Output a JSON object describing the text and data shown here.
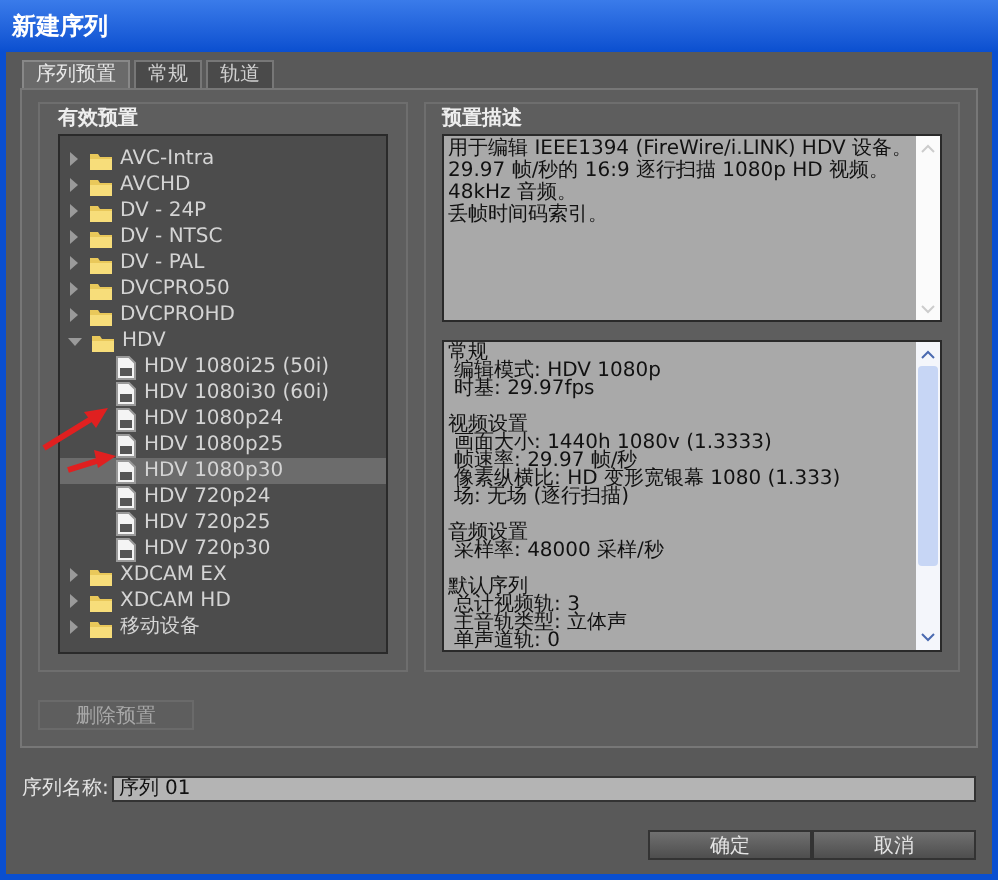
{
  "window": {
    "title": "新建序列"
  },
  "tabs": [
    {
      "label": "序列预置",
      "selected": true
    },
    {
      "label": "常规",
      "selected": false
    },
    {
      "label": "轨道",
      "selected": false
    }
  ],
  "presets": {
    "heading": "有效预置",
    "items": [
      {
        "label": "AVC-Intra",
        "kind": "folder",
        "expanded": false,
        "selected": false
      },
      {
        "label": "AVCHD",
        "kind": "folder",
        "expanded": false,
        "selected": false
      },
      {
        "label": "DV - 24P",
        "kind": "folder",
        "expanded": false,
        "selected": false
      },
      {
        "label": "DV - NTSC",
        "kind": "folder",
        "expanded": false,
        "selected": false
      },
      {
        "label": "DV - PAL",
        "kind": "folder",
        "expanded": false,
        "selected": false
      },
      {
        "label": "DVCPRO50",
        "kind": "folder",
        "expanded": false,
        "selected": false
      },
      {
        "label": "DVCPROHD",
        "kind": "folder",
        "expanded": false,
        "selected": false
      },
      {
        "label": "HDV",
        "kind": "folder",
        "expanded": true,
        "selected": false,
        "children": [
          {
            "label": "HDV 1080i25 (50i)",
            "kind": "preset",
            "selected": false
          },
          {
            "label": "HDV 1080i30 (60i)",
            "kind": "preset",
            "selected": false
          },
          {
            "label": "HDV 1080p24",
            "kind": "preset",
            "selected": false
          },
          {
            "label": "HDV 1080p25",
            "kind": "preset",
            "selected": false
          },
          {
            "label": "HDV 1080p30",
            "kind": "preset",
            "selected": true
          },
          {
            "label": "HDV 720p24",
            "kind": "preset",
            "selected": false
          },
          {
            "label": "HDV 720p25",
            "kind": "preset",
            "selected": false
          },
          {
            "label": "HDV 720p30",
            "kind": "preset",
            "selected": false
          }
        ]
      },
      {
        "label": "XDCAM EX",
        "kind": "folder",
        "expanded": false,
        "selected": false
      },
      {
        "label": "XDCAM HD",
        "kind": "folder",
        "expanded": false,
        "selected": false
      },
      {
        "label": "移动设备",
        "kind": "folder",
        "expanded": false,
        "selected": false
      }
    ],
    "delete_button": {
      "label": "删除预置",
      "disabled": true
    }
  },
  "description": {
    "heading": "预置描述",
    "summary": [
      "用于编辑 IEEE1394 (FireWire/i.LINK) HDV 设备。",
      "29.97 帧/秒的 16:9 逐行扫描 1080p HD 视频。",
      "48kHz 音频。",
      "丢帧时间码索引。"
    ],
    "details": [
      {
        "heading": "常规",
        "lines": [
          "编辑模式: HDV 1080p",
          "时基: 29.97fps"
        ]
      },
      {
        "heading": "视频设置",
        "lines": [
          "画面大小: 1440h 1080v (1.3333)",
          "帧速率: 29.97 帧/秒",
          "像素纵横比: HD 变形宽银幕 1080 (1.333)",
          "场: 无场 (逐行扫描)"
        ]
      },
      {
        "heading": "音频设置",
        "lines": [
          "采样率: 48000 采样/秒"
        ]
      },
      {
        "heading": "默认序列",
        "lines": [
          "总计视频轨: 3",
          "主音轨类型: 立体声",
          "单声道轨: 0"
        ]
      }
    ]
  },
  "sequence_name": {
    "label": "序列名称:",
    "value": "序列 01"
  },
  "buttons": [
    "确定",
    "取消"
  ]
}
